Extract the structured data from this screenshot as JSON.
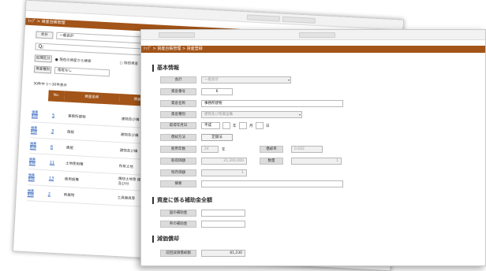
{
  "back_window": {
    "breadcrumb": "ﾄｯﾌﾟ > 資産台帳管理",
    "kaikei_label": "会計",
    "kaikei_value": "一般会計",
    "search_placeholder": "",
    "shoukyaku_label": "処理区分",
    "radio1": "現在の資産から検索",
    "radio2": "除却資産",
    "shisan_shubetsu_label": "資産種別",
    "shisan_shubetsu_value": "指定なし",
    "count_text": "30件中 1〜30件表示",
    "columns": [
      "No.",
      "資産名称",
      "資産区"
    ],
    "rows": [
      {
        "link": "編集 削除",
        "no": "5",
        "name": "事務所建物",
        "category": "建物及び構"
      },
      {
        "link": "編集 削除",
        "no": "3",
        "name": "施設",
        "category": "建物及び構"
      },
      {
        "link": "編集 削除",
        "no": "6",
        "name": "建屋",
        "category": "建物及び構"
      },
      {
        "link": "編集 削除",
        "no": "11",
        "name": "土地使用権",
        "category": "所有土地"
      },
      {
        "link": "編集 削除",
        "no": "13",
        "name": "使用設備",
        "category": "償却土地等 建物及び付"
      },
      {
        "link": "編集 削除",
        "no": "2",
        "name": "附属物",
        "category": "工具器具等"
      }
    ]
  },
  "front_window": {
    "breadcrumb": "ﾄｯﾌﾟ > 資産台帳管理 > 資産登録",
    "section_basic": "基本情報",
    "kaikei_label": "会計",
    "kaikei_value": "一般会計",
    "shisan_bangou_label": "資産番号",
    "shisan_bangou_value": "6",
    "shisan_meishou_label": "資産名称",
    "shisan_meishou_value": "事務所建物",
    "shisan_shubetsu_label": "資産種別",
    "shisan_shubetsu_value": "建物及び附属設備",
    "shutoku_date_label": "取得年月日",
    "era_value": "平成",
    "year_unit": "年",
    "month_unit": "月",
    "day_unit": "日",
    "shoukyaku_houhou_label": "償却方法",
    "shoukyaku_houhou_value": "定額法",
    "taiyou_nensu_label": "耐用年数",
    "taiyou_nensu_value": "24",
    "taiyou_unit": "年",
    "shoukyaku_ritsu_label": "償却率",
    "shoukyaku_ritsu_value": "0.042",
    "shutoku_kagaku_label": "取得価額",
    "shutoku_kagaku_value": "21,300,000",
    "suuryou_label": "数量",
    "suuryou_value": "1",
    "zanzon_label": "残存価額",
    "zanzon_value": "1",
    "bikou_label": "摘要",
    "bikou_value": "",
    "section_subsidy": "資産に係る補助金全額",
    "kuni_label": "国の補助金",
    "kuni_value": "",
    "ken_label": "県の補助金",
    "ken_value": "",
    "section_depreciation": "減価償却",
    "zenki_label": "前回減価償却額",
    "zenki_value": "81,230"
  }
}
